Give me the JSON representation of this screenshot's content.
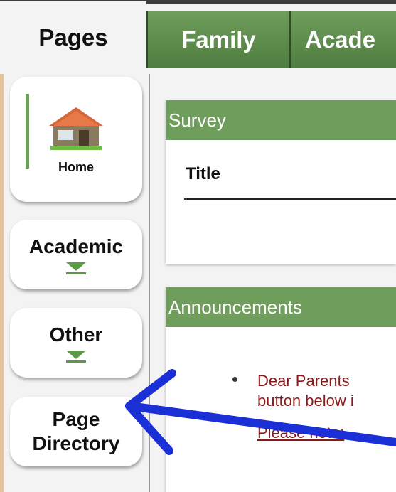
{
  "tabs": {
    "pages": "Pages",
    "family": "Family",
    "academic": "Acade"
  },
  "sidebar": {
    "home": "Home",
    "academic": "Academic",
    "other": "Other",
    "directory_line1": "Page",
    "directory_line2": "Directory"
  },
  "survey": {
    "header": "Survey",
    "title": "Title"
  },
  "announcements": {
    "header": "Announcements",
    "line1": "Dear Parents",
    "line2": "button below i",
    "note": "Please note:"
  },
  "colors": {
    "accent_green": "#6f9d5b",
    "arrow_blue": "#1a2fd6",
    "announcement_text": "#8a1a1a"
  }
}
